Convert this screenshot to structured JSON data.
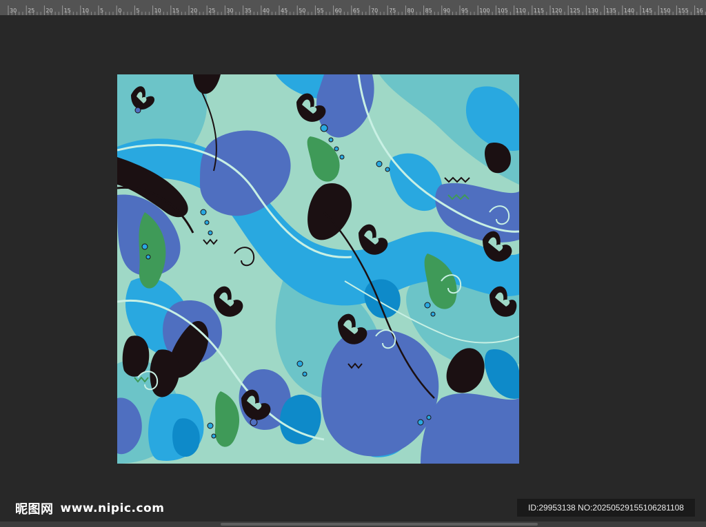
{
  "ruler": {
    "labels": [
      "30",
      "25",
      "20",
      "15",
      "10",
      "5",
      "0",
      "5",
      "10",
      "15",
      "20",
      "25",
      "30",
      "35",
      "40",
      "45",
      "50",
      "55",
      "60",
      "65",
      "70",
      "75",
      "80",
      "85",
      "90",
      "95",
      "100",
      "105",
      "110",
      "115",
      "120",
      "125",
      "130",
      "135",
      "140",
      "145",
      "150",
      "155",
      "16"
    ]
  },
  "watermark": {
    "site_name": "昵图网",
    "url": "www.nipic.com"
  },
  "image_id": "ID:29953138 NO:20250529155106281108",
  "colors": {
    "workspace": "#282828",
    "ruler": "#535353",
    "sky_blue": "#29a8e0",
    "periwinkle": "#4f6fc0",
    "mint": "#9fd8c6",
    "teal": "#6cc4c8",
    "ocean": "#0e8ac9",
    "green": "#3f9a58",
    "dark": "#1b1012"
  }
}
